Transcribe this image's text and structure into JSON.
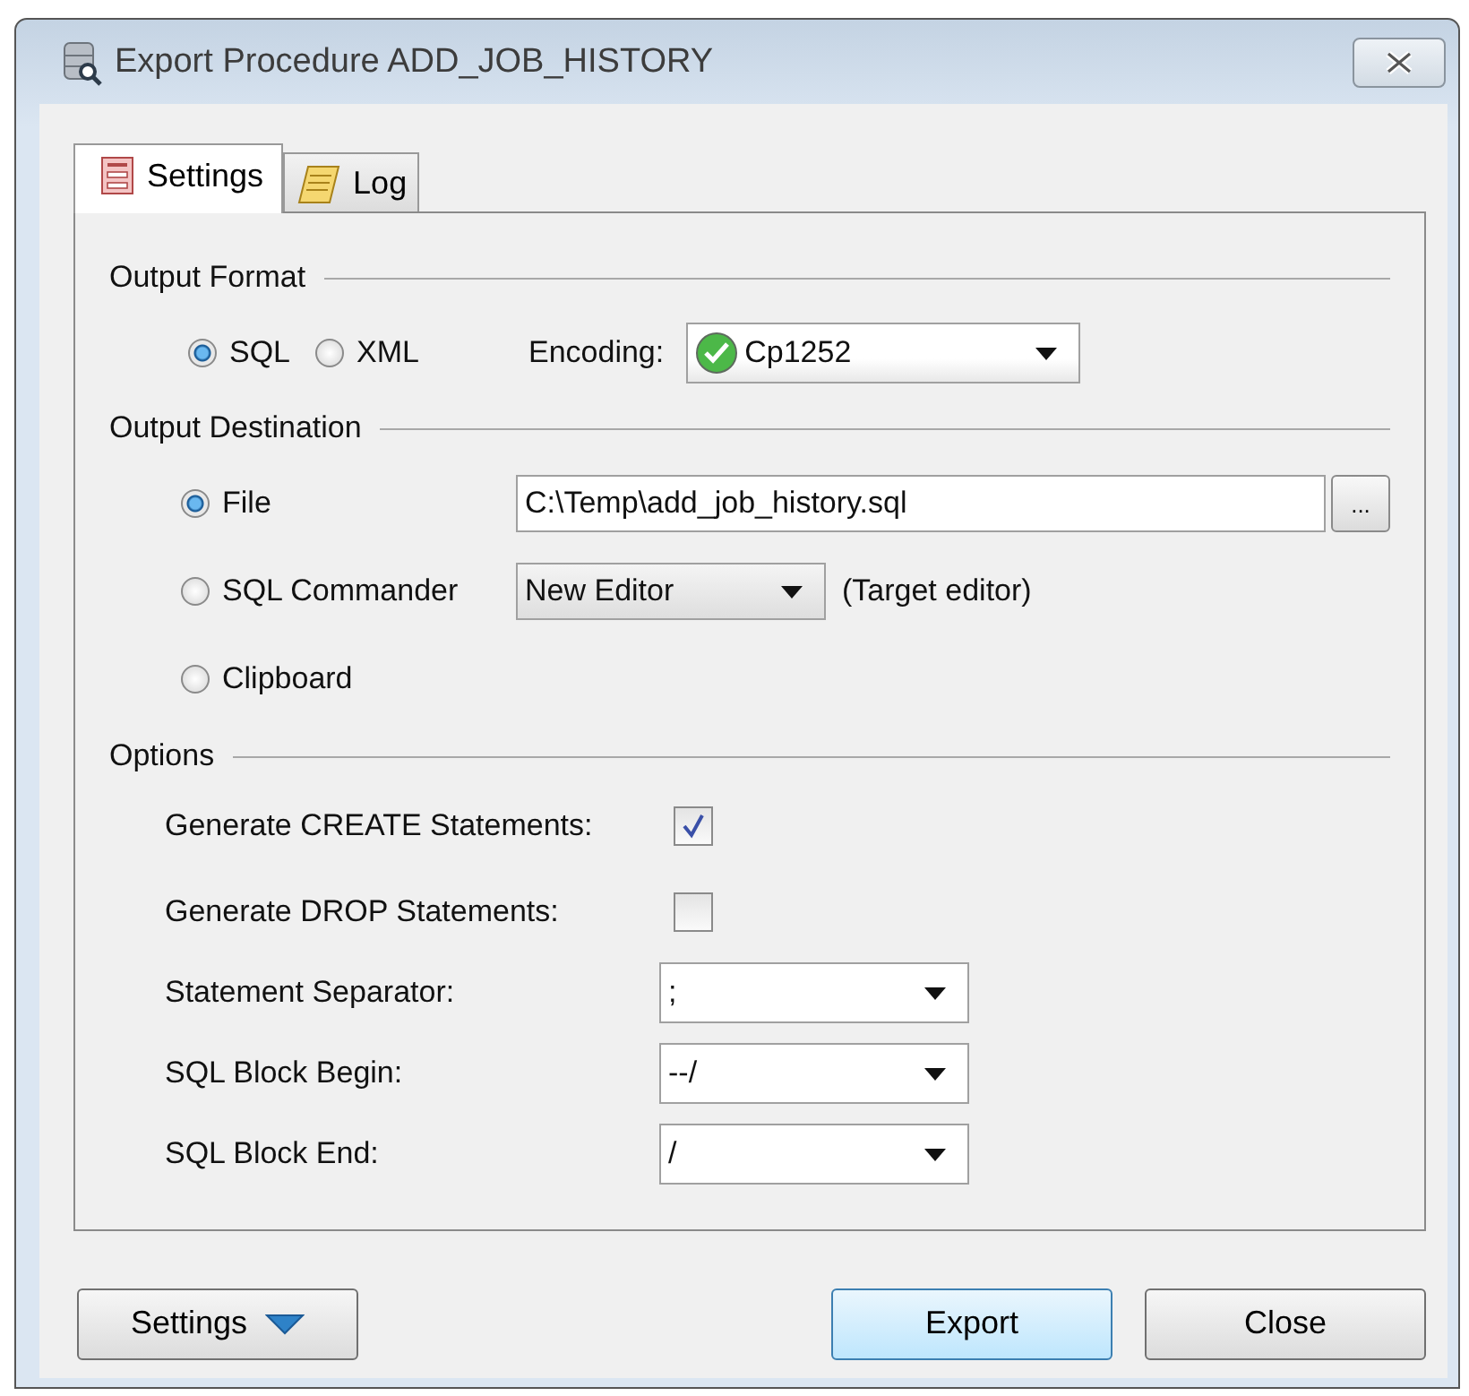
{
  "window": {
    "title": "Export Procedure ADD_JOB_HISTORY"
  },
  "tabs": [
    {
      "label": "Settings",
      "selected": true,
      "kind": "settings"
    },
    {
      "label": "Log",
      "selected": false,
      "kind": "log"
    }
  ],
  "output_format": {
    "title": "Output Format",
    "formats": [
      {
        "label": "SQL",
        "selected": true
      },
      {
        "label": "XML",
        "selected": false
      }
    ],
    "encoding": {
      "label": "Encoding:",
      "value": "Cp1252"
    }
  },
  "output_destination": {
    "title": "Output Destination",
    "destinations": [
      {
        "kind": "file",
        "label": "File",
        "selected": true,
        "value": "C:\\Temp\\add_job_history.sql",
        "browse": "..."
      },
      {
        "kind": "editor",
        "label": "SQL Commander",
        "selected": false,
        "value": "New Editor",
        "note": "(Target editor)"
      },
      {
        "kind": "clipboard",
        "label": "Clipboard",
        "selected": false
      }
    ]
  },
  "options": {
    "title": "Options",
    "items": [
      {
        "kind": "checkbox",
        "label": "Generate CREATE Statements:",
        "checked": true
      },
      {
        "kind": "checkbox",
        "label": "Generate DROP Statements:",
        "checked": false
      },
      {
        "kind": "dropdown",
        "label": "Statement Separator:",
        "value": ";"
      },
      {
        "kind": "dropdown",
        "label": "SQL Block Begin:",
        "value": "--/"
      },
      {
        "kind": "dropdown",
        "label": "SQL Block End:",
        "value": "/"
      }
    ]
  },
  "buttons": [
    {
      "kind": "menu",
      "label": "Settings",
      "default": false
    },
    {
      "kind": "push",
      "label": "Export",
      "default": true
    },
    {
      "kind": "push",
      "label": "Close",
      "default": false
    }
  ]
}
